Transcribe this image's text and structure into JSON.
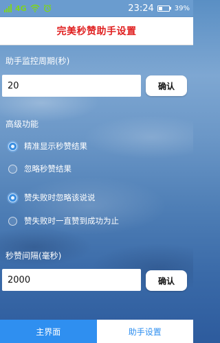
{
  "status_bar": {
    "network": "4G",
    "time": "23:24",
    "battery_percent": "39%",
    "battery_level": 0.39,
    "icons": [
      "signal-icon",
      "wifi-icon",
      "alarm-icon",
      "battery-icon"
    ]
  },
  "title": "完美秒赞助手设置",
  "monitor": {
    "label": "助手监控周期(秒)",
    "value": "20",
    "confirm_label": "确认"
  },
  "advanced": {
    "label": "高级功能",
    "options": [
      {
        "label": "精准显示秒赞结果",
        "checked": true
      },
      {
        "label": "忽略秒赞结果",
        "checked": false
      },
      {
        "label": "赞失败时忽略该说说",
        "checked": true
      },
      {
        "label": "赞失败时一直赞到成功为止",
        "checked": false
      }
    ]
  },
  "interval": {
    "label": "秒赞间隔(毫秒)",
    "value": "2000",
    "confirm_label": "确认"
  },
  "tabs": {
    "home": "主界面",
    "settings": "助手设置"
  },
  "colors": {
    "title": "#e02020",
    "accent": "#2f8ff0",
    "network": "#7ed321"
  }
}
